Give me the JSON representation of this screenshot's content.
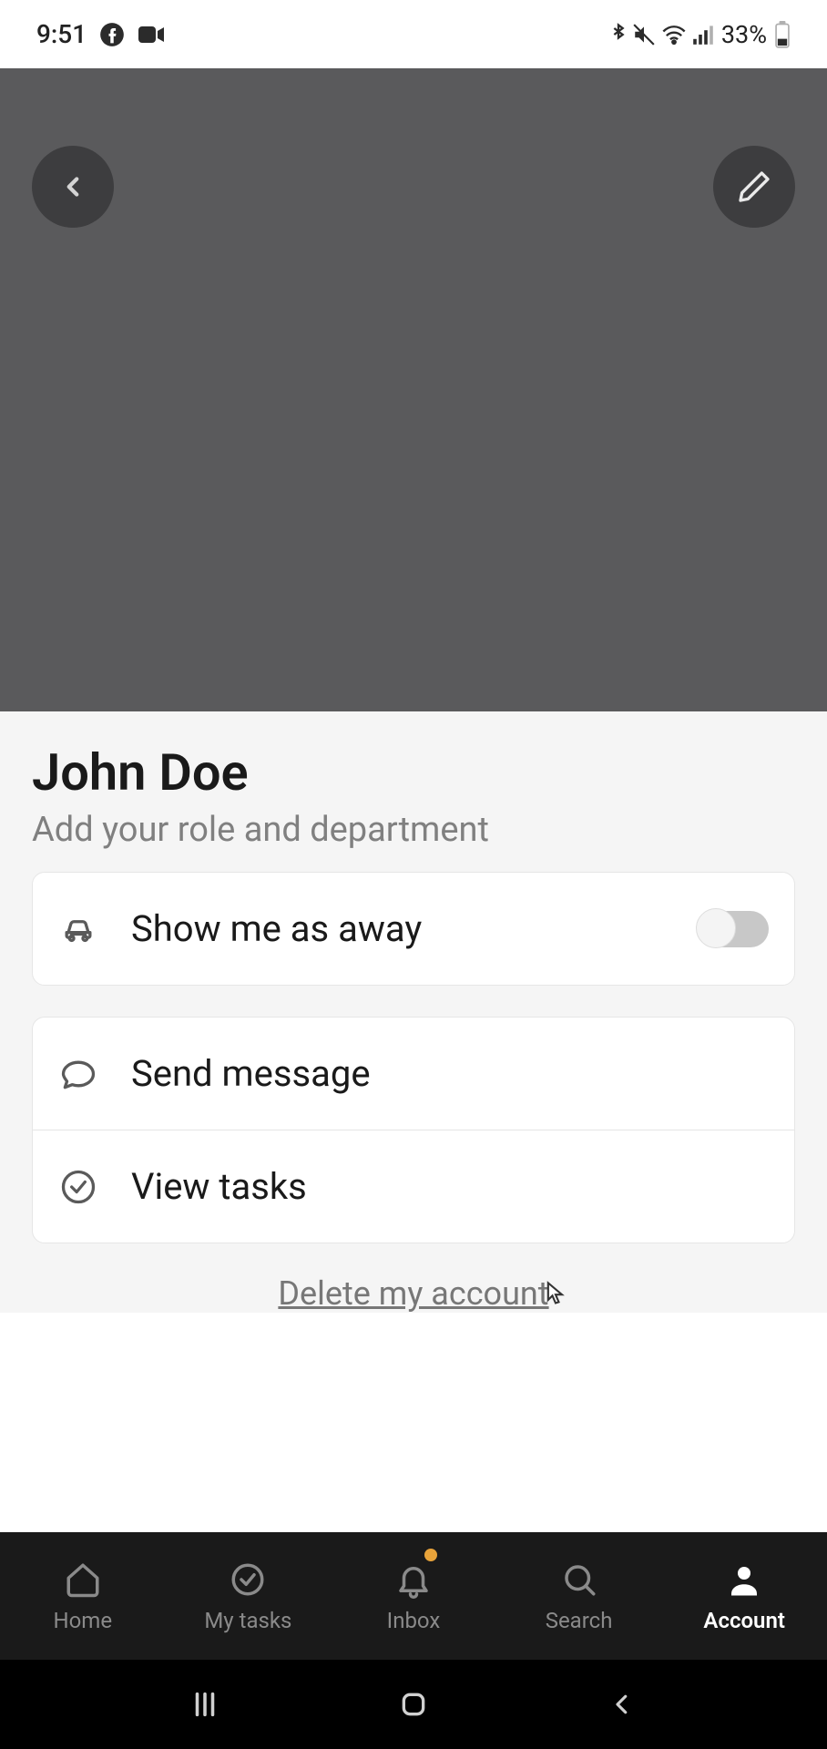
{
  "status": {
    "time": "9:51",
    "battery": "33%"
  },
  "profile": {
    "name": "John Doe",
    "role_placeholder": "Add your role and department"
  },
  "rows": {
    "away": "Show me as away",
    "send": "Send message",
    "tasks": "View tasks"
  },
  "delete_link": "Delete my account",
  "nav": {
    "home": "Home",
    "mytasks": "My tasks",
    "inbox": "Inbox",
    "search": "Search",
    "account": "Account"
  }
}
